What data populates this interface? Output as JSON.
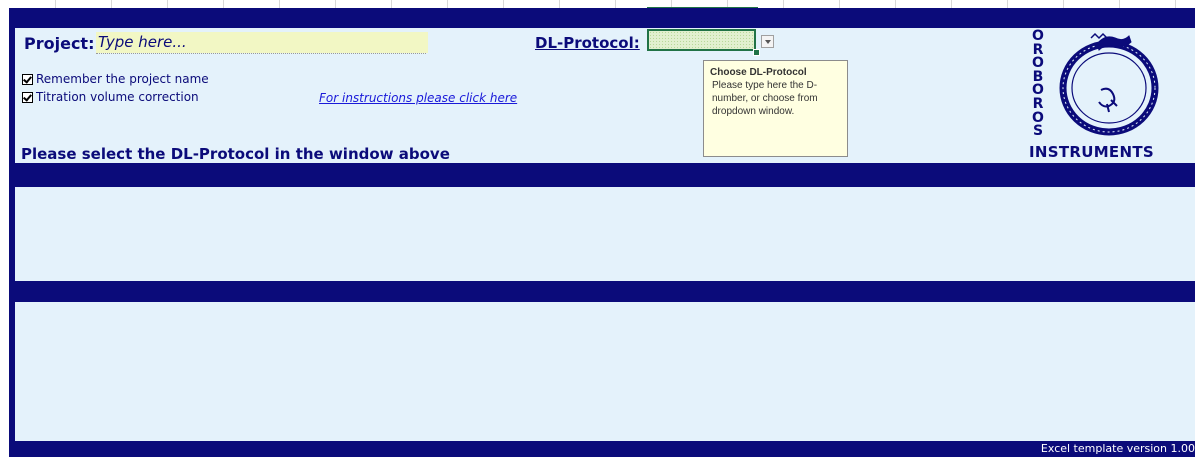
{
  "project": {
    "label": "Project:",
    "placeholder": "Type here..."
  },
  "options": {
    "remember_label": "Remember the project name",
    "remember_checked": true,
    "titration_label": "Titration volume correction",
    "titration_checked": true
  },
  "instructions_link": "For instructions please click here",
  "select_message": "Please select the DL-Protocol in the window above",
  "dl_protocol": {
    "label": "DL-Protocol:",
    "value": ""
  },
  "tooltip": {
    "title": "Choose DL-Protocol",
    "body": "Please type here the D-number, or choose from dropdown window."
  },
  "logo": {
    "vertical_text": "OROBOROS",
    "horizontal_text": "INSTRUMENTS"
  },
  "footer": {
    "version_text": "Excel template version 1.00"
  },
  "colors": {
    "navy": "#0b0b7a",
    "panel": "#e4f2fb",
    "input_fill": "#f2f7c4",
    "tooltip_bg": "#ffffe1",
    "selection_green": "#217346"
  }
}
